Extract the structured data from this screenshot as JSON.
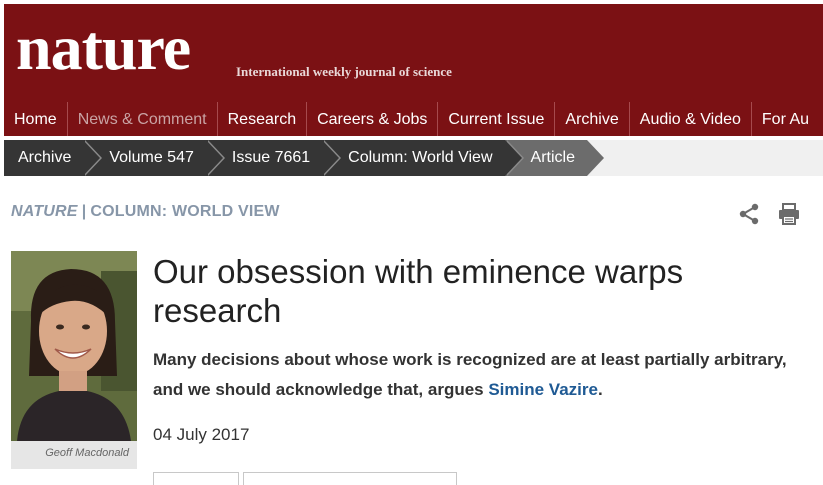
{
  "masthead": {
    "logo": "nature",
    "tagline": "International weekly journal of science"
  },
  "nav": {
    "items": [
      {
        "label": "Home"
      },
      {
        "label": "News & Comment",
        "active": true
      },
      {
        "label": "Research"
      },
      {
        "label": "Careers & Jobs"
      },
      {
        "label": "Current Issue"
      },
      {
        "label": "Archive"
      },
      {
        "label": "Audio & Video"
      },
      {
        "label": "For Au"
      }
    ]
  },
  "breadcrumb": {
    "items": [
      "Archive",
      "Volume 547",
      "Issue 7661",
      "Column: World View",
      "Article"
    ]
  },
  "section": {
    "journal": "NATURE",
    "separator": "|",
    "column": "COLUMN: WORLD VIEW"
  },
  "tools": {
    "share_icon": "share-icon",
    "print_icon": "print-icon"
  },
  "photo": {
    "credit": "Geoff Macdonald"
  },
  "article": {
    "title": "Our obsession with eminence warps research",
    "standfirst_text": "Many decisions about whose work is recognized are at least partially arbitrary, and we should acknowledge that, argues ",
    "author": "Simine Vazire",
    "standfirst_end": ".",
    "date": "04 July 2017"
  },
  "colors": {
    "brand": "#7b1114",
    "breadcrumb": "#353535",
    "link": "#1f5a94",
    "section_label": "#8796a8"
  }
}
